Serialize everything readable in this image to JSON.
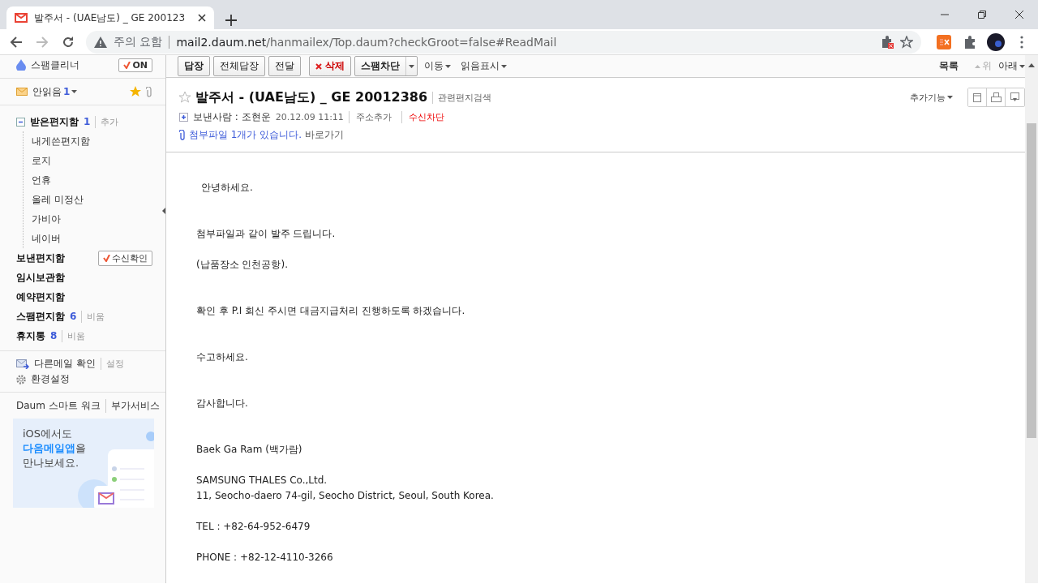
{
  "browser": {
    "tab_title": "발주서 - (UAE남도) _ GE 200123",
    "url_warning": "주의 요함",
    "url_host": "mail2.daum.net",
    "url_path": "/hanmailex/Top.daum?checkGroot=false#ReadMail"
  },
  "sidebar": {
    "spam_cleaner": {
      "label": "스팸클리너",
      "toggle": "ON",
      "on": true
    },
    "unread": {
      "label": "안읽음",
      "count": "1"
    },
    "folders": [
      {
        "label": "받은편지함",
        "count": "1",
        "action": "추가",
        "expanded": true,
        "children": [
          {
            "label": "내게쓴편지함"
          },
          {
            "label": "로지"
          },
          {
            "label": "언휴"
          },
          {
            "label": "올레 미정산"
          },
          {
            "label": "가비아"
          },
          {
            "label": "네이버"
          }
        ]
      },
      {
        "label": "보낸편지함",
        "button": "수신확인"
      },
      {
        "label": "임시보관함"
      },
      {
        "label": "예약편지함"
      },
      {
        "label": "스팸편지함",
        "count": "6",
        "action": "비움"
      },
      {
        "label": "휴지통",
        "count": "8",
        "action": "비움"
      }
    ],
    "other_mail": {
      "label": "다른메일 확인",
      "action": "설정"
    },
    "settings": "환경설정",
    "links": [
      "Daum 스마트 워크",
      "부가서비스"
    ],
    "banner": [
      "iOS에서도",
      "**다음메일앱**을",
      "만나보세요."
    ]
  },
  "toolbar": {
    "buttons": [
      {
        "kind": "button",
        "label": "답장"
      },
      {
        "kind": "button",
        "label": "전체답장"
      },
      {
        "kind": "button",
        "label": "전달"
      },
      {
        "kind": "delete",
        "label": "삭제"
      },
      {
        "kind": "split",
        "label": "스팸차단"
      },
      {
        "kind": "menu",
        "label": "이동"
      },
      {
        "kind": "menu",
        "label": "읽음표시"
      }
    ],
    "right": [
      {
        "label": "목록",
        "kind": "bold",
        "disabled": false
      },
      {
        "label": "위",
        "kind": "up",
        "disabled": true
      },
      {
        "label": "아래",
        "kind": "down",
        "disabled": false
      }
    ]
  },
  "message": {
    "subject": "발주서 - (UAE남도) _ GE 20012386",
    "related": "관련편지검색",
    "extra": "추가기능",
    "starred": false,
    "sender": "보낸사람 : 조현운",
    "date": "20.12.09 11:11",
    "add_address": "주소추가",
    "block": "수신차단",
    "attachment": "첨부파일 1개가 있습니다.",
    "goto": "바로가기",
    "body": [
      {
        "kind": "line",
        "text": "안녕하세요."
      },
      {
        "kind": "blank"
      },
      {
        "kind": "blank"
      },
      {
        "kind": "line",
        "text": "첨부파일과 같이 발주 드립니다."
      },
      {
        "kind": "blank"
      },
      {
        "kind": "line",
        "text": "(납품장소 인천공항)."
      },
      {
        "kind": "blank"
      },
      {
        "kind": "blank"
      },
      {
        "kind": "line",
        "text": "확인 후 P.I 회신 주시면 대금지급처리 진행하도록 하겠습니다."
      },
      {
        "kind": "blank"
      },
      {
        "kind": "blank"
      },
      {
        "kind": "line",
        "text": "수고하세요."
      },
      {
        "kind": "blank"
      },
      {
        "kind": "blank"
      },
      {
        "kind": "line",
        "text": "감사합니다."
      },
      {
        "kind": "blank"
      },
      {
        "kind": "blank"
      },
      {
        "kind": "line",
        "text": "Baek Ga Ram (백가람)"
      },
      {
        "kind": "blank"
      },
      {
        "kind": "line",
        "text": "SAMSUNG THALES Co.,Ltd."
      },
      {
        "kind": "line",
        "text": "11, Seocho-daero 74-gil, Seocho District, Seoul, South Korea."
      },
      {
        "kind": "blank"
      },
      {
        "kind": "line",
        "text": "TEL : +82-64-952-6479"
      },
      {
        "kind": "blank"
      },
      {
        "kind": "line",
        "text": "PHONE : +82-12-4110-3266"
      }
    ]
  }
}
